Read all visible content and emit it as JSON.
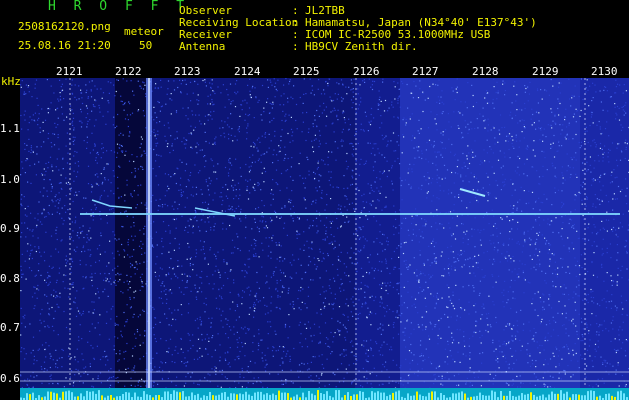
{
  "app": {
    "brand": "H R O F F T",
    "filename": "2508162120.png",
    "timestamp": "25.08.16 21:20",
    "mode_label": "meteor",
    "count": "50"
  },
  "info": {
    "labels": [
      "Observer",
      "Receiving Location",
      "Receiver",
      "Antenna"
    ],
    "values": [
      "JL2TBB",
      "Hamamatsu, Japan (N34°40' E137°43')",
      "ICOM IC-R2500 53.1000MHz USB",
      "HB9CV Zenith dir."
    ]
  },
  "axis": {
    "unit_label": "kHz",
    "y_ticks": [
      "1.1",
      "1.0",
      "0.9",
      "0.8",
      "0.7",
      "0.6"
    ],
    "time_ticks": [
      "2121",
      "2122",
      "2123",
      "2124",
      "2125",
      "2126",
      "2127",
      "2128",
      "2129",
      "2130"
    ]
  },
  "colors": {
    "background": "#000000",
    "waterfall_base": "#101a8a",
    "signal": "#7fd7ff",
    "header_green": "#2fd82f",
    "header_yellow": "#f2f200"
  }
}
